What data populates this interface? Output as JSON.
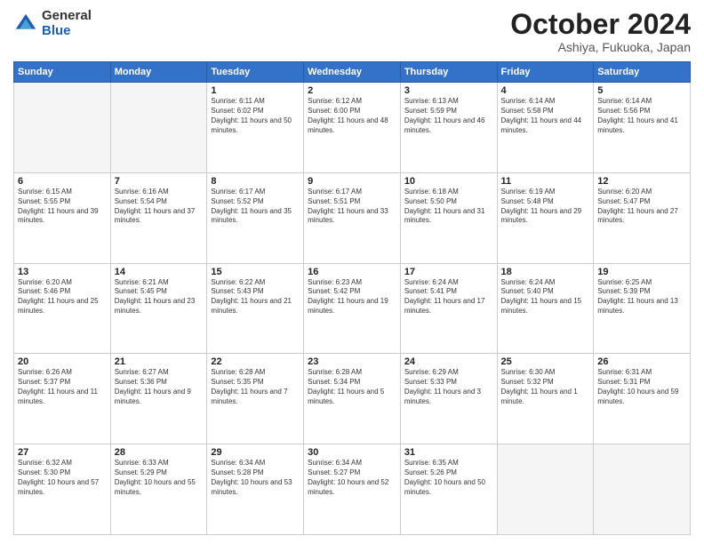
{
  "header": {
    "logo_general": "General",
    "logo_blue": "Blue",
    "month": "October 2024",
    "location": "Ashiya, Fukuoka, Japan"
  },
  "days_of_week": [
    "Sunday",
    "Monday",
    "Tuesday",
    "Wednesday",
    "Thursday",
    "Friday",
    "Saturday"
  ],
  "weeks": [
    [
      {
        "day": "",
        "content": ""
      },
      {
        "day": "",
        "content": ""
      },
      {
        "day": "1",
        "content": "Sunrise: 6:11 AM\nSunset: 6:02 PM\nDaylight: 11 hours and 50 minutes."
      },
      {
        "day": "2",
        "content": "Sunrise: 6:12 AM\nSunset: 6:00 PM\nDaylight: 11 hours and 48 minutes."
      },
      {
        "day": "3",
        "content": "Sunrise: 6:13 AM\nSunset: 5:59 PM\nDaylight: 11 hours and 46 minutes."
      },
      {
        "day": "4",
        "content": "Sunrise: 6:14 AM\nSunset: 5:58 PM\nDaylight: 11 hours and 44 minutes."
      },
      {
        "day": "5",
        "content": "Sunrise: 6:14 AM\nSunset: 5:56 PM\nDaylight: 11 hours and 41 minutes."
      }
    ],
    [
      {
        "day": "6",
        "content": "Sunrise: 6:15 AM\nSunset: 5:55 PM\nDaylight: 11 hours and 39 minutes."
      },
      {
        "day": "7",
        "content": "Sunrise: 6:16 AM\nSunset: 5:54 PM\nDaylight: 11 hours and 37 minutes."
      },
      {
        "day": "8",
        "content": "Sunrise: 6:17 AM\nSunset: 5:52 PM\nDaylight: 11 hours and 35 minutes."
      },
      {
        "day": "9",
        "content": "Sunrise: 6:17 AM\nSunset: 5:51 PM\nDaylight: 11 hours and 33 minutes."
      },
      {
        "day": "10",
        "content": "Sunrise: 6:18 AM\nSunset: 5:50 PM\nDaylight: 11 hours and 31 minutes."
      },
      {
        "day": "11",
        "content": "Sunrise: 6:19 AM\nSunset: 5:48 PM\nDaylight: 11 hours and 29 minutes."
      },
      {
        "day": "12",
        "content": "Sunrise: 6:20 AM\nSunset: 5:47 PM\nDaylight: 11 hours and 27 minutes."
      }
    ],
    [
      {
        "day": "13",
        "content": "Sunrise: 6:20 AM\nSunset: 5:46 PM\nDaylight: 11 hours and 25 minutes."
      },
      {
        "day": "14",
        "content": "Sunrise: 6:21 AM\nSunset: 5:45 PM\nDaylight: 11 hours and 23 minutes."
      },
      {
        "day": "15",
        "content": "Sunrise: 6:22 AM\nSunset: 5:43 PM\nDaylight: 11 hours and 21 minutes."
      },
      {
        "day": "16",
        "content": "Sunrise: 6:23 AM\nSunset: 5:42 PM\nDaylight: 11 hours and 19 minutes."
      },
      {
        "day": "17",
        "content": "Sunrise: 6:24 AM\nSunset: 5:41 PM\nDaylight: 11 hours and 17 minutes."
      },
      {
        "day": "18",
        "content": "Sunrise: 6:24 AM\nSunset: 5:40 PM\nDaylight: 11 hours and 15 minutes."
      },
      {
        "day": "19",
        "content": "Sunrise: 6:25 AM\nSunset: 5:39 PM\nDaylight: 11 hours and 13 minutes."
      }
    ],
    [
      {
        "day": "20",
        "content": "Sunrise: 6:26 AM\nSunset: 5:37 PM\nDaylight: 11 hours and 11 minutes."
      },
      {
        "day": "21",
        "content": "Sunrise: 6:27 AM\nSunset: 5:36 PM\nDaylight: 11 hours and 9 minutes."
      },
      {
        "day": "22",
        "content": "Sunrise: 6:28 AM\nSunset: 5:35 PM\nDaylight: 11 hours and 7 minutes."
      },
      {
        "day": "23",
        "content": "Sunrise: 6:28 AM\nSunset: 5:34 PM\nDaylight: 11 hours and 5 minutes."
      },
      {
        "day": "24",
        "content": "Sunrise: 6:29 AM\nSunset: 5:33 PM\nDaylight: 11 hours and 3 minutes."
      },
      {
        "day": "25",
        "content": "Sunrise: 6:30 AM\nSunset: 5:32 PM\nDaylight: 11 hours and 1 minute."
      },
      {
        "day": "26",
        "content": "Sunrise: 6:31 AM\nSunset: 5:31 PM\nDaylight: 10 hours and 59 minutes."
      }
    ],
    [
      {
        "day": "27",
        "content": "Sunrise: 6:32 AM\nSunset: 5:30 PM\nDaylight: 10 hours and 57 minutes."
      },
      {
        "day": "28",
        "content": "Sunrise: 6:33 AM\nSunset: 5:29 PM\nDaylight: 10 hours and 55 minutes."
      },
      {
        "day": "29",
        "content": "Sunrise: 6:34 AM\nSunset: 5:28 PM\nDaylight: 10 hours and 53 minutes."
      },
      {
        "day": "30",
        "content": "Sunrise: 6:34 AM\nSunset: 5:27 PM\nDaylight: 10 hours and 52 minutes."
      },
      {
        "day": "31",
        "content": "Sunrise: 6:35 AM\nSunset: 5:26 PM\nDaylight: 10 hours and 50 minutes."
      },
      {
        "day": "",
        "content": ""
      },
      {
        "day": "",
        "content": ""
      }
    ]
  ]
}
